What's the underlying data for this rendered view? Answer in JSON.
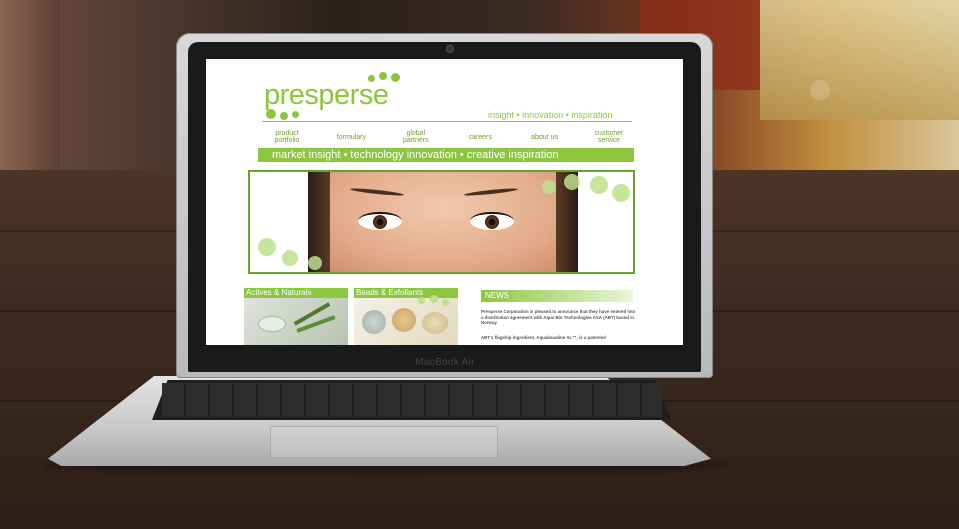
{
  "device": {
    "label": "MacBook Air"
  },
  "site": {
    "logo_text": "presperse",
    "tagline": "insight • innovation • inspiration",
    "nav": [
      "product\nportfolio",
      "formulary",
      "global\npartners",
      "careers",
      "about us",
      "customer\nservice"
    ],
    "banner": "market insight • technology innovation • creative inspiration",
    "cards": [
      {
        "title": "Actives & Naturals"
      },
      {
        "title": "Beads & Exfoliants"
      }
    ],
    "news": {
      "heading": "NEWS",
      "paragraph_1": "Presperse Corporation is pleased to announce that they have entered into a distribution agreement with Aqua Bio Technologies ASA (ABT) based in Norway.",
      "paragraph_2": "ABT's flagship ingredient, Aquabeautine XL™, is a patented"
    },
    "colors": {
      "brand_green": "#8cc63f",
      "dark_green": "#6aa12a"
    }
  }
}
